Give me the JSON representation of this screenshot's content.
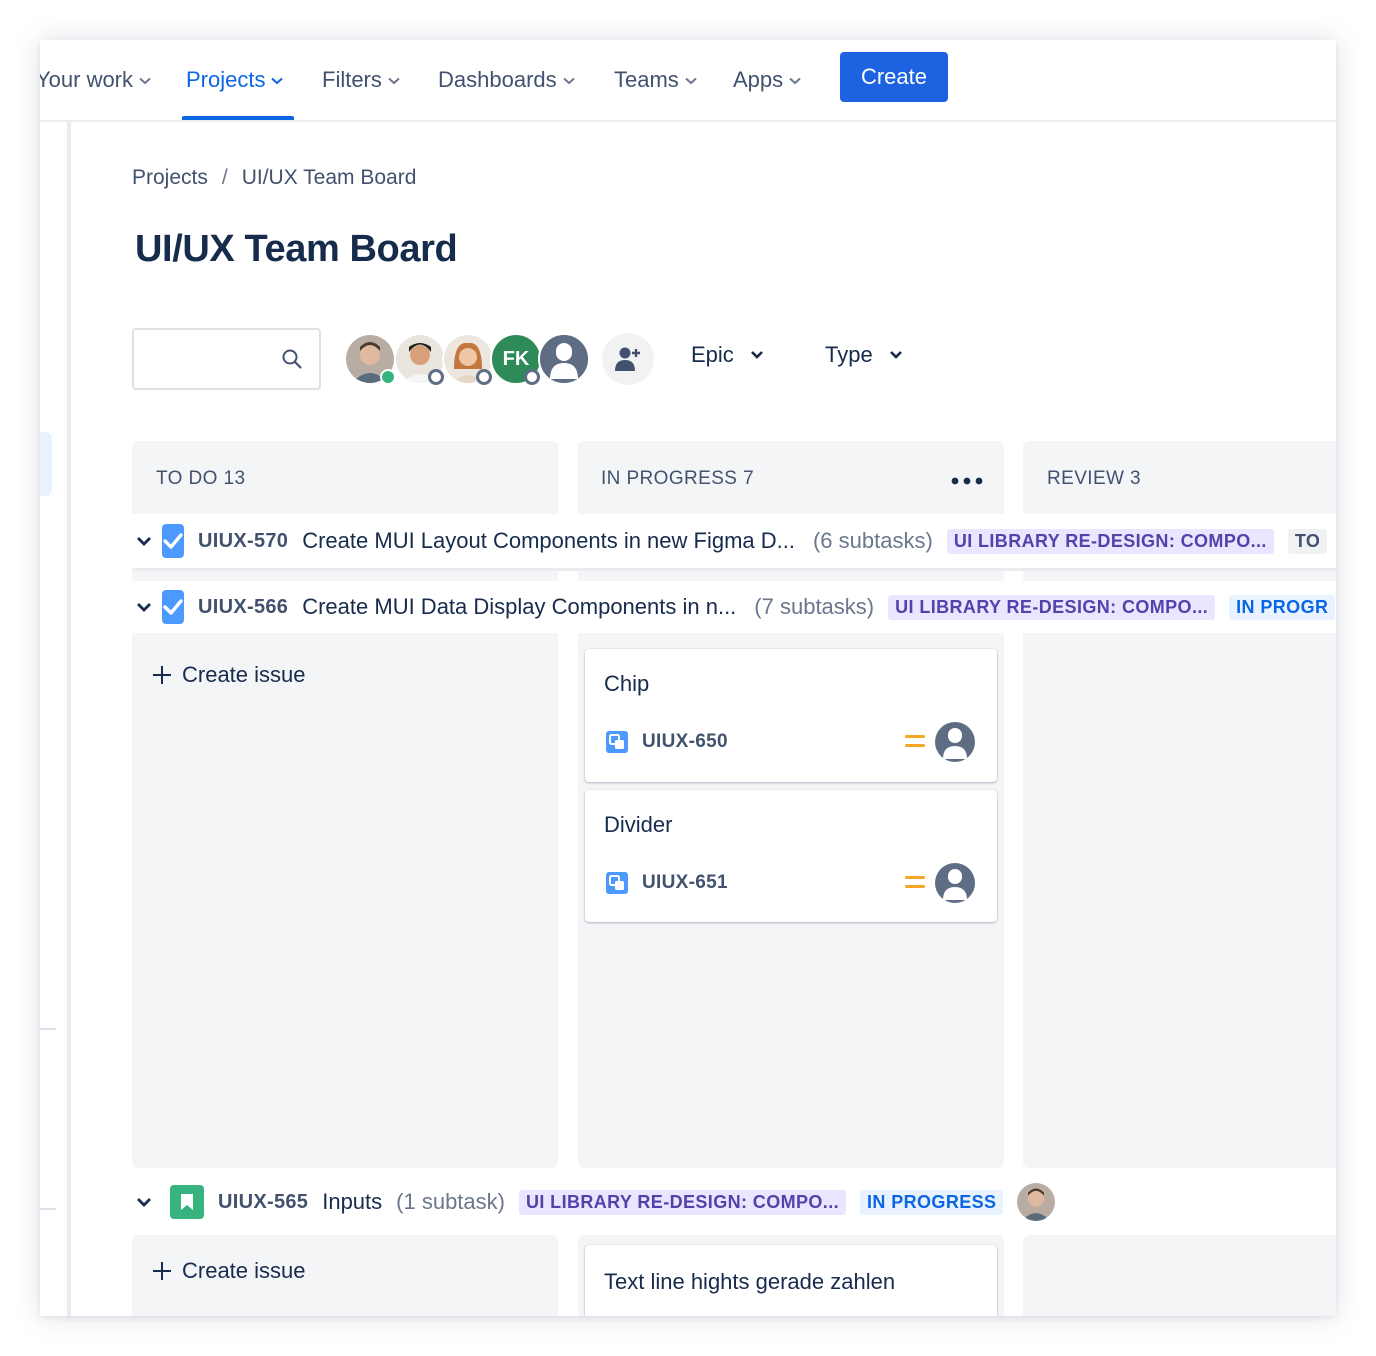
{
  "nav": {
    "items": [
      {
        "label": "Your work"
      },
      {
        "label": "Projects"
      },
      {
        "label": "Filters"
      },
      {
        "label": "Dashboards"
      },
      {
        "label": "Teams"
      },
      {
        "label": "Apps"
      }
    ],
    "active": "Projects",
    "create_label": "Create",
    "accent": "#0c66e4"
  },
  "breadcrumb": {
    "items": [
      "Projects",
      "UI/UX Team Board"
    ],
    "separator": "/"
  },
  "page": {
    "title": "UI/UX Team Board"
  },
  "toolbar": {
    "search_placeholder": "",
    "avatars": [
      {
        "type": "photo",
        "status": "online"
      },
      {
        "type": "photo",
        "status": "away"
      },
      {
        "type": "photo",
        "status": "away"
      },
      {
        "type": "initials",
        "initials": "FK",
        "color": "#2e8b57",
        "status": "away"
      },
      {
        "type": "placeholder"
      }
    ],
    "add_people_icon": "add-person-icon",
    "filters": [
      {
        "label": "Epic"
      },
      {
        "label": "Type"
      }
    ]
  },
  "columns": [
    {
      "name": "TO DO",
      "count": "13"
    },
    {
      "name": "IN PROGRESS",
      "count": "7"
    },
    {
      "name": "REVIEW",
      "count": "3"
    }
  ],
  "swimlanes": [
    {
      "key": "UIUX-570",
      "summary": "Create MUI Layout Components in new Figma D...",
      "subtasks": "(6 subtasks)",
      "epic": "UI LIBRARY RE-DESIGN: COMPO...",
      "status": "TO",
      "icon": "checkbox-icon"
    },
    {
      "key": "UIUX-566",
      "summary": "Create MUI Data Display Components in n...",
      "subtasks": "(7 subtasks)",
      "epic": "UI LIBRARY RE-DESIGN: COMPO...",
      "status": "IN PROGR",
      "icon": "checkbox-icon",
      "cards_in_progress": [
        {
          "title": "Chip",
          "key": "UIUX-650",
          "priority": "medium"
        },
        {
          "title": "Divider",
          "key": "UIUX-651",
          "priority": "medium"
        }
      ]
    },
    {
      "key": "UIUX-565",
      "summary": "Inputs",
      "subtasks": "(1 subtask)",
      "epic": "UI LIBRARY RE-DESIGN: COMPO...",
      "status": "IN PROGRESS",
      "icon": "story-icon",
      "cards_in_progress": [
        {
          "title": "Text line hights gerade zahlen"
        }
      ]
    }
  ],
  "create_issue_label": "Create issue",
  "colors": {
    "column_bg": "#f4f5f7",
    "epic_bg": "#eae6ff",
    "epic_text": "#5243aa",
    "progress_bg": "#e9f2ff",
    "progress_text": "#0c66e4",
    "priority_medium": "#f5a623"
  }
}
